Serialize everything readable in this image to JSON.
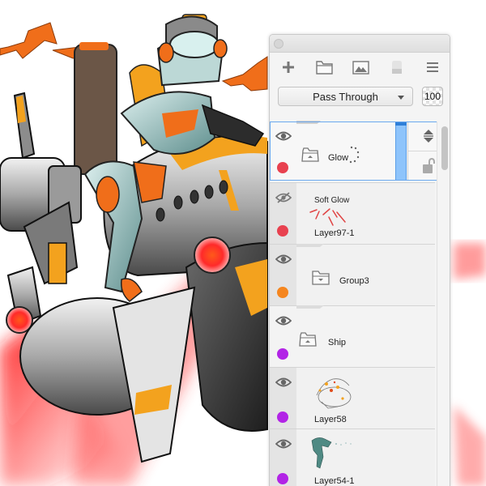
{
  "toolbar": {
    "icons": [
      "add-layer-icon",
      "new-group-folder-icon",
      "image-layer-icon",
      "mask-icon",
      "menu-icon"
    ]
  },
  "blend": {
    "mode": "Pass Through",
    "opacity": "100"
  },
  "colors": {
    "red_tag": "#e8414f",
    "orange_tag": "#f5861f",
    "purple_tag": "#b224e6",
    "selection": "#6aa8ee",
    "glow_red": "#ff1a1a",
    "accent_orange": "#f39c1a"
  },
  "layers": [
    {
      "name": "Glow",
      "type": "group",
      "visible": true,
      "tag": "red",
      "selected": true
    },
    {
      "name": "Layer97-1",
      "preview_label": "Soft Glow",
      "type": "layer",
      "visible": false,
      "tag": "red"
    },
    {
      "name": "Group3",
      "type": "group",
      "visible": true,
      "tag": "orange"
    },
    {
      "name": "Ship",
      "type": "group",
      "visible": true,
      "tag": "purple"
    },
    {
      "name": "Layer58",
      "type": "layer",
      "visible": true,
      "tag": "purple"
    },
    {
      "name": "Layer54-1",
      "type": "layer",
      "visible": true,
      "tag": "purple"
    }
  ],
  "side_controls": {
    "move": "move-up-down-icon",
    "lock": "unlock-icon"
  }
}
